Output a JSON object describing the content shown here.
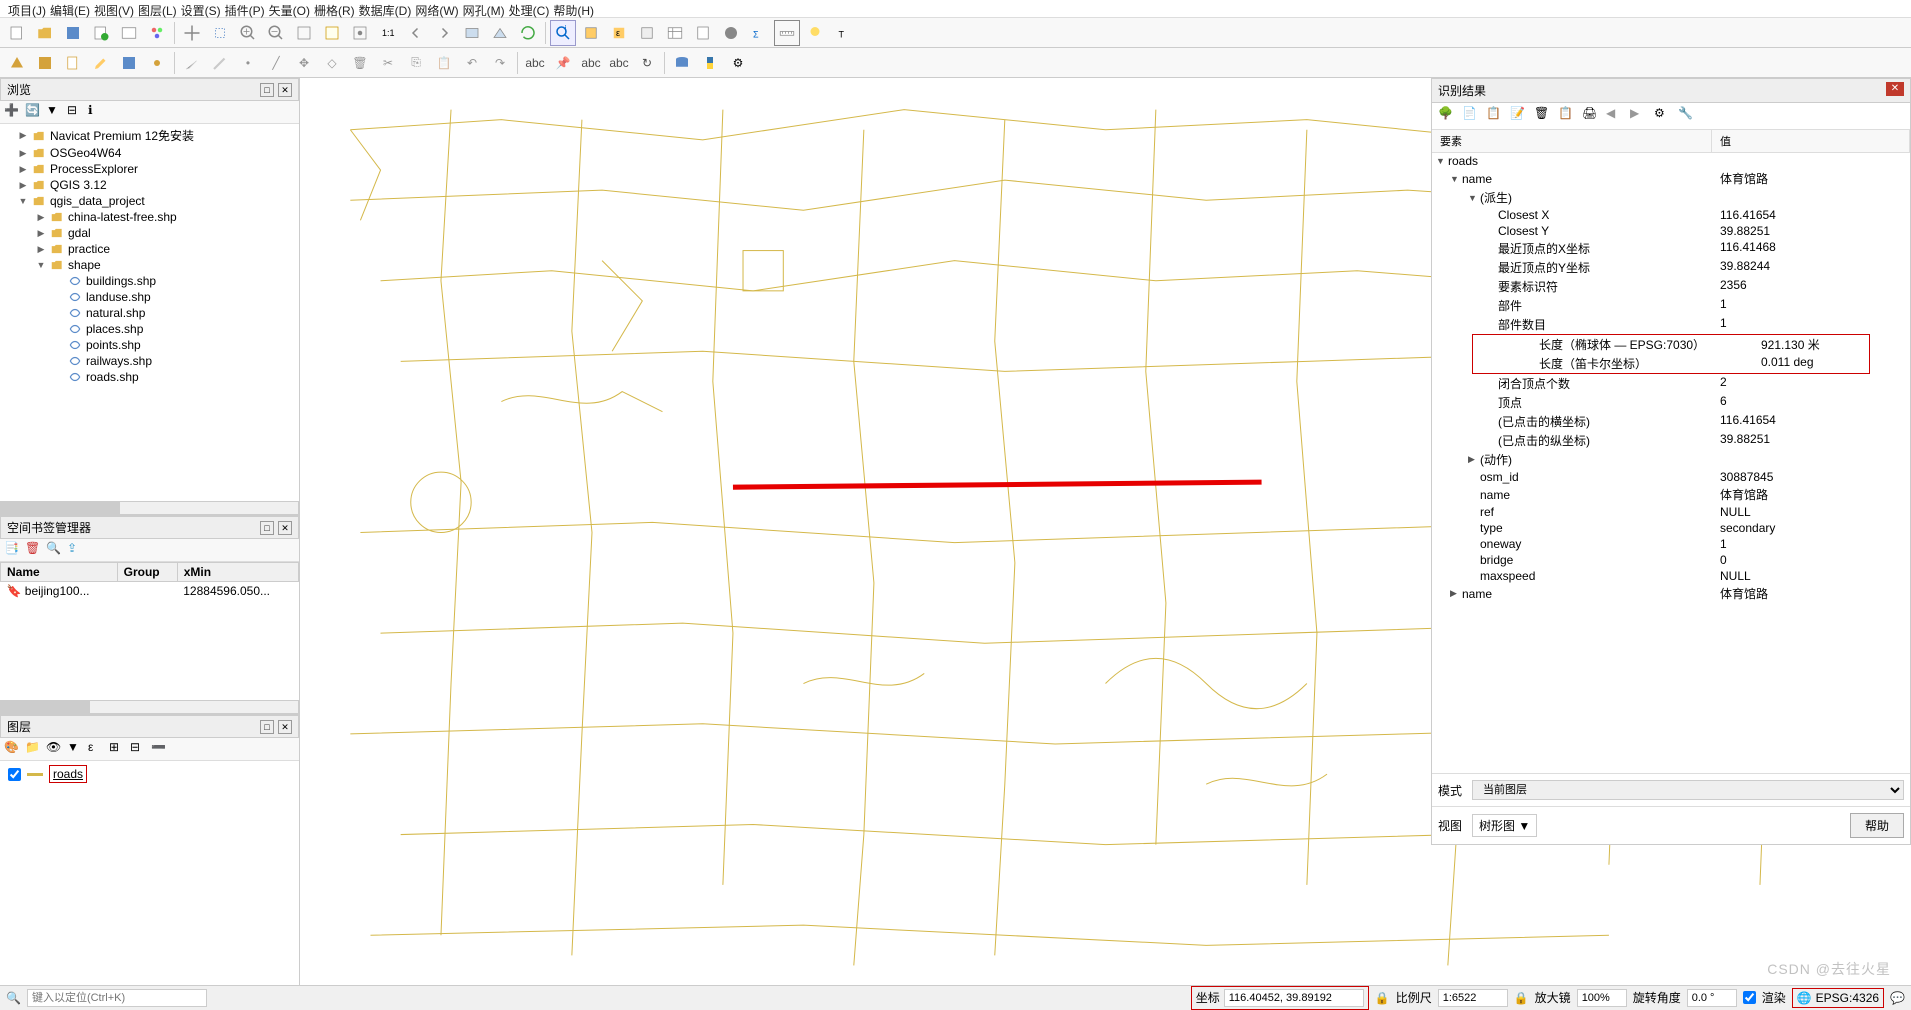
{
  "menu": [
    "项目(J)",
    "编辑(E)",
    "视图(V)",
    "图层(L)",
    "设置(S)",
    "插件(P)",
    "矢量(O)",
    "栅格(R)",
    "数据库(D)",
    "网络(W)",
    "网孔(M)",
    "处理(C)",
    "帮助(H)"
  ],
  "browser": {
    "title": "浏览",
    "items": [
      {
        "lvl": 1,
        "arrow": "▶",
        "icon": "folder",
        "label": "Navicat Premium 12免安装"
      },
      {
        "lvl": 1,
        "arrow": "▶",
        "icon": "folder",
        "label": "OSGeo4W64"
      },
      {
        "lvl": 1,
        "arrow": "▶",
        "icon": "folder",
        "label": "ProcessExplorer"
      },
      {
        "lvl": 1,
        "arrow": "▶",
        "icon": "folder",
        "label": "QGIS 3.12"
      },
      {
        "lvl": 1,
        "arrow": "▼",
        "icon": "folder",
        "label": "qgis_data_project"
      },
      {
        "lvl": 2,
        "arrow": "▶",
        "icon": "folder",
        "label": "china-latest-free.shp"
      },
      {
        "lvl": 2,
        "arrow": "▶",
        "icon": "folder",
        "label": "gdal"
      },
      {
        "lvl": 2,
        "arrow": "▶",
        "icon": "folder",
        "label": "practice"
      },
      {
        "lvl": 2,
        "arrow": "▼",
        "icon": "folder",
        "label": "shape"
      },
      {
        "lvl": 3,
        "arrow": "",
        "icon": "shp",
        "label": "buildings.shp"
      },
      {
        "lvl": 3,
        "arrow": "",
        "icon": "shp",
        "label": "landuse.shp"
      },
      {
        "lvl": 3,
        "arrow": "",
        "icon": "shp",
        "label": "natural.shp"
      },
      {
        "lvl": 3,
        "arrow": "",
        "icon": "shp",
        "label": "places.shp"
      },
      {
        "lvl": 3,
        "arrow": "",
        "icon": "shp",
        "label": "points.shp"
      },
      {
        "lvl": 3,
        "arrow": "",
        "icon": "shp",
        "label": "railways.shp"
      },
      {
        "lvl": 3,
        "arrow": "",
        "icon": "shp",
        "label": "roads.shp"
      }
    ]
  },
  "bookmark": {
    "title": "空间书签管理器",
    "headers": [
      "Name",
      "Group",
      "xMin"
    ],
    "rows": [
      [
        "beijing100...",
        "",
        "12884596.050..."
      ]
    ]
  },
  "layers": {
    "title": "图层",
    "items": [
      {
        "checked": true,
        "name": "roads"
      }
    ]
  },
  "identify": {
    "title": "识别结果",
    "th": {
      "feature": "要素",
      "value": "值"
    },
    "rows": [
      {
        "lvl": 0,
        "arrow": "▼",
        "label": "roads",
        "val": ""
      },
      {
        "lvl": 1,
        "arrow": "▼",
        "label": "name",
        "val": "体育馆路"
      },
      {
        "lvl": 2,
        "arrow": "▼",
        "label": "(派生)",
        "val": ""
      },
      {
        "lvl": 3,
        "arrow": "",
        "label": "Closest X",
        "val": "116.41654"
      },
      {
        "lvl": 3,
        "arrow": "",
        "label": "Closest Y",
        "val": "39.88251"
      },
      {
        "lvl": 3,
        "arrow": "",
        "label": "最近顶点的X坐标",
        "val": "116.41468"
      },
      {
        "lvl": 3,
        "arrow": "",
        "label": "最近顶点的Y坐标",
        "val": "39.88244"
      },
      {
        "lvl": 3,
        "arrow": "",
        "label": "要素标识符",
        "val": "2356"
      },
      {
        "lvl": 3,
        "arrow": "",
        "label": "部件",
        "val": "1"
      },
      {
        "lvl": 3,
        "arrow": "",
        "label": "部件数目",
        "val": "1"
      },
      {
        "lvl": 3,
        "arrow": "",
        "label": "长度（椭球体 — EPSG:7030）",
        "val": "921.130 米",
        "hl": true
      },
      {
        "lvl": 3,
        "arrow": "",
        "label": "长度（笛卡尔坐标）",
        "val": "0.011 deg",
        "hl": true
      },
      {
        "lvl": 3,
        "arrow": "",
        "label": "闭合顶点个数",
        "val": "2"
      },
      {
        "lvl": 3,
        "arrow": "",
        "label": "顶点",
        "val": "6"
      },
      {
        "lvl": 3,
        "arrow": "",
        "label": "(已点击的横坐标)",
        "val": "116.41654"
      },
      {
        "lvl": 3,
        "arrow": "",
        "label": "(已点击的纵坐标)",
        "val": "39.88251"
      },
      {
        "lvl": 2,
        "arrow": "▶",
        "label": "(动作)",
        "val": ""
      },
      {
        "lvl": 2,
        "arrow": "",
        "label": "osm_id",
        "val": "30887845"
      },
      {
        "lvl": 2,
        "arrow": "",
        "label": "name",
        "val": "体育馆路"
      },
      {
        "lvl": 2,
        "arrow": "",
        "label": "ref",
        "val": "NULL"
      },
      {
        "lvl": 2,
        "arrow": "",
        "label": "type",
        "val": "secondary"
      },
      {
        "lvl": 2,
        "arrow": "",
        "label": "oneway",
        "val": "1"
      },
      {
        "lvl": 2,
        "arrow": "",
        "label": "bridge",
        "val": "0"
      },
      {
        "lvl": 2,
        "arrow": "",
        "label": "maxspeed",
        "val": "NULL"
      },
      {
        "lvl": 1,
        "arrow": "▶",
        "label": "name",
        "val": "体育馆路"
      }
    ],
    "mode_label": "模式",
    "mode_value": "当前图层",
    "view_label": "视图",
    "view_value": "树形图 ▼",
    "help": "帮助"
  },
  "status": {
    "locate_ph": "键入以定位(Ctrl+K)",
    "coord_label": "坐标",
    "coord_value": "116.40452, 39.89192",
    "scale_label": "比例尺",
    "scale_value": "1:6522",
    "mag_label": "放大镜",
    "mag_value": "100%",
    "rot_label": "旋转角度",
    "rot_value": "0.0 °",
    "render": "渲染",
    "crs": "EPSG:4326"
  },
  "watermark": "CSDN @去往火星"
}
